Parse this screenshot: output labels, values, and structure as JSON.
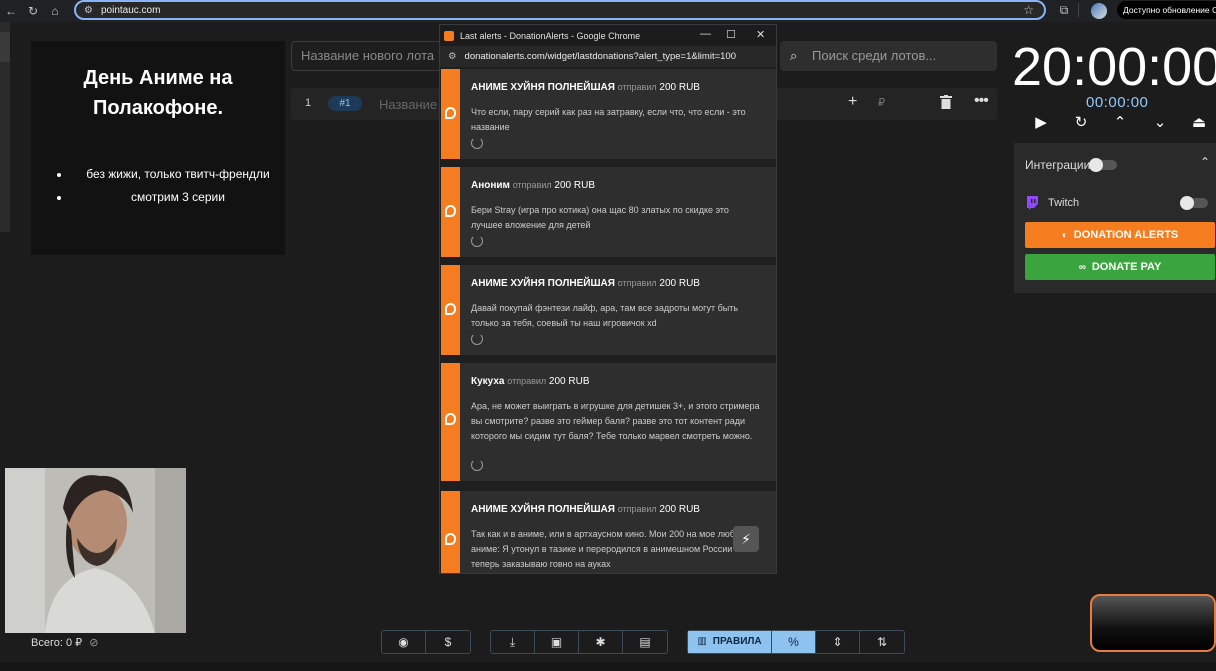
{
  "browser": {
    "url": "pointauc.com",
    "update_label": "Доступно обновление Chrome"
  },
  "description_card": {
    "title": "День Аниме на Полакофоне.",
    "items": [
      "без жижи, только твитч-френдли",
      "смотрим 3 серии"
    ]
  },
  "lot_input": {
    "placeholder": "Название нового лота"
  },
  "lot_row": {
    "index": "1",
    "tag": "#1",
    "name_placeholder": "Название",
    "ruble": "₽"
  },
  "search": {
    "placeholder": "Поиск среди лотов..."
  },
  "timer": {
    "main": "20:00:00",
    "sub": "00:00:00"
  },
  "integrations": {
    "title": "Интеграции",
    "twitch_label": "Twitch",
    "donation_alerts_label": "DONATION ALERTS",
    "donate_pay_label": "DONATE PAY"
  },
  "popup": {
    "window_title": "Last alerts - DonationAlerts - Google Chrome",
    "url": "donationalerts.com/widget/lastdonations?alert_type=1&limit=100",
    "sent_word": "отправил",
    "alerts": [
      {
        "name": "АНИМЕ ХУЙНЯ ПОЛНЕЙШАЯ",
        "amount": "200 RUB",
        "message": "Что если, пару серий как раз на затравку, если что, что если - это название"
      },
      {
        "name": "Аноним",
        "amount": "200 RUB",
        "message": "Бери Stray (игра про котика) она щас 80 златых по скидке это лучшее вложение для детей"
      },
      {
        "name": "АНИМЕ ХУЙНЯ ПОЛНЕЙШАЯ",
        "amount": "200 RUB",
        "message": "Давай покупай фэнтези лайф, ара, там все задроты могут быть только за тебя, соевый ты наш игровичок xd"
      },
      {
        "name": "Кукуха",
        "amount": "200 RUB",
        "message": "Ара, не может выиграть в игрушке для детишек 3+, и этого стримера вы смотрите? разве это геймер баля? разве это тот контент ради которого мы сидим тут баля? Тебе только марвел смотреть можно."
      },
      {
        "name": "АНИМЕ ХУЙНЯ ПОЛНЕЙШАЯ",
        "amount": "200 RUB",
        "message": "Так как и в аниме, или в артхаусном кино. Мои 200 на мое любимое аниме: Я утонул в тазике и переродился в анимешном России и теперь заказываю говно на ауках"
      }
    ]
  },
  "footer": {
    "total": "Всего: 0 ₽",
    "rules_label": "ПРАВИЛА",
    "percent": "%"
  },
  "colors": {
    "accent_orange": "#f57c1f",
    "accent_green": "#3aa53e",
    "accent_blue": "#8ec3f0"
  }
}
